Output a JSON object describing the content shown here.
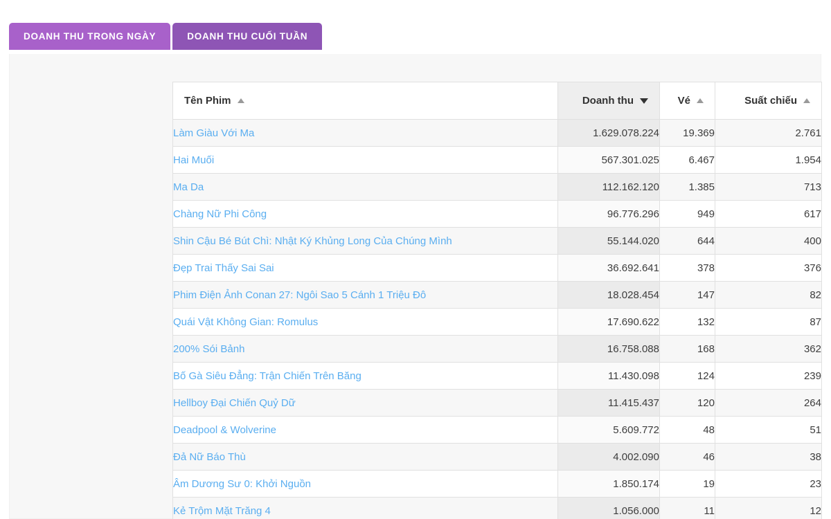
{
  "tabs": [
    {
      "label": "DOANH THU TRONG NGÀY",
      "active": true
    },
    {
      "label": "DOANH THU CUỐI TUẦN",
      "active": false
    }
  ],
  "colors": {
    "tab_active": "#a861ca",
    "tab_inactive": "#8e55b5",
    "link": "#5aaef0",
    "panel_bg": "#f7f7f7",
    "sorted_header_bg": "#eeeeee"
  },
  "table": {
    "columns": [
      {
        "label": "Tên Phim",
        "align": "left",
        "sort": "asc",
        "sorted": false,
        "icon": "sort-asc-icon"
      },
      {
        "label": "Doanh thu",
        "align": "right",
        "sort": "desc",
        "sorted": true,
        "icon": "sort-desc-icon"
      },
      {
        "label": "Vé",
        "align": "right",
        "sort": "asc",
        "sorted": false,
        "icon": "sort-asc-icon"
      },
      {
        "label": "Suất chiếu",
        "align": "right",
        "sort": "asc",
        "sorted": false,
        "icon": "sort-asc-icon"
      }
    ],
    "rows": [
      {
        "name": "Làm Giàu Với Ma",
        "revenue": "1.629.078.224",
        "tickets": "19.369",
        "shows": "2.761"
      },
      {
        "name": "Hai Muối",
        "revenue": "567.301.025",
        "tickets": "6.467",
        "shows": "1.954"
      },
      {
        "name": "Ma Da",
        "revenue": "112.162.120",
        "tickets": "1.385",
        "shows": "713"
      },
      {
        "name": "Chàng Nữ Phi Công",
        "revenue": "96.776.296",
        "tickets": "949",
        "shows": "617"
      },
      {
        "name": "Shin Cậu Bé Bút Chì: Nhật Ký Khủng Long Của Chúng Mình",
        "revenue": "55.144.020",
        "tickets": "644",
        "shows": "400"
      },
      {
        "name": "Đẹp Trai Thấy Sai Sai",
        "revenue": "36.692.641",
        "tickets": "378",
        "shows": "376"
      },
      {
        "name": "Phim Điện Ảnh Conan 27: Ngôi Sao 5 Cánh 1 Triệu Đô",
        "revenue": "18.028.454",
        "tickets": "147",
        "shows": "82"
      },
      {
        "name": "Quái Vật Không Gian: Romulus",
        "revenue": "17.690.622",
        "tickets": "132",
        "shows": "87"
      },
      {
        "name": "200% Sói Bảnh",
        "revenue": "16.758.088",
        "tickets": "168",
        "shows": "362"
      },
      {
        "name": "Bố Gà Siêu Đẳng: Trận Chiến Trên Băng",
        "revenue": "11.430.098",
        "tickets": "124",
        "shows": "239"
      },
      {
        "name": "Hellboy Đại Chiến Quỷ Dữ",
        "revenue": "11.415.437",
        "tickets": "120",
        "shows": "264"
      },
      {
        "name": "Deadpool & Wolverine",
        "revenue": "5.609.772",
        "tickets": "48",
        "shows": "51"
      },
      {
        "name": "Đả Nữ Báo Thù",
        "revenue": "4.002.090",
        "tickets": "46",
        "shows": "38"
      },
      {
        "name": "Âm Dương Sư 0: Khởi Nguồn",
        "revenue": "1.850.174",
        "tickets": "19",
        "shows": "23"
      },
      {
        "name": "Kẻ Trộm Mặt Trăng 4",
        "revenue": "1.056.000",
        "tickets": "11",
        "shows": "12"
      }
    ]
  }
}
